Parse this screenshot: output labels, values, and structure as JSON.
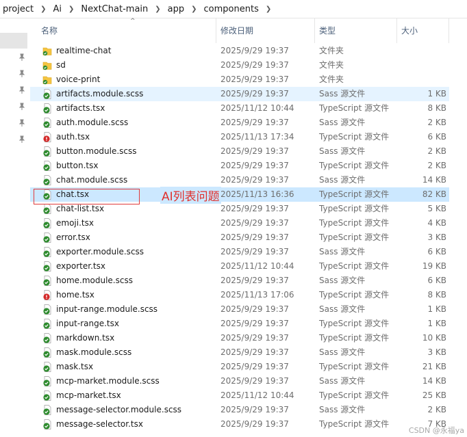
{
  "breadcrumb": [
    "project",
    "Ai",
    "NextChat-main",
    "app",
    "components"
  ],
  "header": {
    "name": "名称",
    "date": "修改日期",
    "type": "类型",
    "size": "大小"
  },
  "colors": {
    "selected_row": "#cce8ff",
    "hover_row": "#e5f3ff",
    "annotation_red": "#e03a3a",
    "ok_badge": "#2e8b2e",
    "error_badge": "#d42a2a",
    "folder_yellow": "#f5c542"
  },
  "files": [
    {
      "name": "realtime-chat",
      "date": "2025/9/29 19:37",
      "type": "文件夹",
      "size": "",
      "icon": "folder-icon",
      "status": "ok"
    },
    {
      "name": "sd",
      "date": "2025/9/29 19:37",
      "type": "文件夹",
      "size": "",
      "icon": "folder-icon",
      "status": "ok"
    },
    {
      "name": "voice-print",
      "date": "2025/9/29 19:37",
      "type": "文件夹",
      "size": "",
      "icon": "folder-icon",
      "status": "ok"
    },
    {
      "name": "artifacts.module.scss",
      "date": "2025/9/29 19:37",
      "type": "Sass 源文件",
      "size": "1 KB",
      "icon": "file-ok-icon",
      "status": "ok",
      "state": "hl"
    },
    {
      "name": "artifacts.tsx",
      "date": "2025/11/12 10:44",
      "type": "TypeScript 源文件",
      "size": "8 KB",
      "icon": "file-ok-icon",
      "status": "ok"
    },
    {
      "name": "auth.module.scss",
      "date": "2025/9/29 19:37",
      "type": "Sass 源文件",
      "size": "2 KB",
      "icon": "file-ok-icon",
      "status": "ok"
    },
    {
      "name": "auth.tsx",
      "date": "2025/11/13 17:34",
      "type": "TypeScript 源文件",
      "size": "6 KB",
      "icon": "file-error-icon",
      "status": "error"
    },
    {
      "name": "button.module.scss",
      "date": "2025/9/29 19:37",
      "type": "Sass 源文件",
      "size": "2 KB",
      "icon": "file-ok-icon",
      "status": "ok"
    },
    {
      "name": "button.tsx",
      "date": "2025/9/29 19:37",
      "type": "TypeScript 源文件",
      "size": "2 KB",
      "icon": "file-ok-icon",
      "status": "ok"
    },
    {
      "name": "chat.module.scss",
      "date": "2025/9/29 19:37",
      "type": "Sass 源文件",
      "size": "14 KB",
      "icon": "file-ok-icon",
      "status": "ok"
    },
    {
      "name": "chat.tsx",
      "date": "2025/11/13 16:36",
      "type": "TypeScript 源文件",
      "size": "82 KB",
      "icon": "file-ok-icon",
      "status": "ok",
      "state": "sel"
    },
    {
      "name": "chat-list.tsx",
      "date": "2025/9/29 19:37",
      "type": "TypeScript 源文件",
      "size": "5 KB",
      "icon": "file-ok-icon",
      "status": "ok"
    },
    {
      "name": "emoji.tsx",
      "date": "2025/9/29 19:37",
      "type": "TypeScript 源文件",
      "size": "4 KB",
      "icon": "file-ok-icon",
      "status": "ok"
    },
    {
      "name": "error.tsx",
      "date": "2025/9/29 19:37",
      "type": "TypeScript 源文件",
      "size": "3 KB",
      "icon": "file-ok-icon",
      "status": "ok"
    },
    {
      "name": "exporter.module.scss",
      "date": "2025/9/29 19:37",
      "type": "Sass 源文件",
      "size": "6 KB",
      "icon": "file-ok-icon",
      "status": "ok"
    },
    {
      "name": "exporter.tsx",
      "date": "2025/11/12 10:44",
      "type": "TypeScript 源文件",
      "size": "19 KB",
      "icon": "file-ok-icon",
      "status": "ok"
    },
    {
      "name": "home.module.scss",
      "date": "2025/9/29 19:37",
      "type": "Sass 源文件",
      "size": "6 KB",
      "icon": "file-ok-icon",
      "status": "ok"
    },
    {
      "name": "home.tsx",
      "date": "2025/11/13 17:06",
      "type": "TypeScript 源文件",
      "size": "8 KB",
      "icon": "file-error-icon",
      "status": "error"
    },
    {
      "name": "input-range.module.scss",
      "date": "2025/9/29 19:37",
      "type": "Sass 源文件",
      "size": "1 KB",
      "icon": "file-ok-icon",
      "status": "ok"
    },
    {
      "name": "input-range.tsx",
      "date": "2025/9/29 19:37",
      "type": "TypeScript 源文件",
      "size": "1 KB",
      "icon": "file-ok-icon",
      "status": "ok"
    },
    {
      "name": "markdown.tsx",
      "date": "2025/9/29 19:37",
      "type": "TypeScript 源文件",
      "size": "10 KB",
      "icon": "file-ok-icon",
      "status": "ok"
    },
    {
      "name": "mask.module.scss",
      "date": "2025/9/29 19:37",
      "type": "Sass 源文件",
      "size": "3 KB",
      "icon": "file-ok-icon",
      "status": "ok"
    },
    {
      "name": "mask.tsx",
      "date": "2025/9/29 19:37",
      "type": "TypeScript 源文件",
      "size": "21 KB",
      "icon": "file-ok-icon",
      "status": "ok"
    },
    {
      "name": "mcp-market.module.scss",
      "date": "2025/9/29 19:37",
      "type": "Sass 源文件",
      "size": "14 KB",
      "icon": "file-ok-icon",
      "status": "ok"
    },
    {
      "name": "mcp-market.tsx",
      "date": "2025/11/12 10:44",
      "type": "TypeScript 源文件",
      "size": "25 KB",
      "icon": "file-ok-icon",
      "status": "ok"
    },
    {
      "name": "message-selector.module.scss",
      "date": "2025/9/29 19:37",
      "type": "Sass 源文件",
      "size": "2 KB",
      "icon": "file-ok-icon",
      "status": "ok"
    },
    {
      "name": "message-selector.tsx",
      "date": "2025/9/29 19:37",
      "type": "TypeScript 源文件",
      "size": "7 KB",
      "icon": "file-ok-icon",
      "status": "ok"
    }
  ],
  "annotation": {
    "text": "AI列表问题"
  },
  "watermark": "CSDN @永福ya"
}
